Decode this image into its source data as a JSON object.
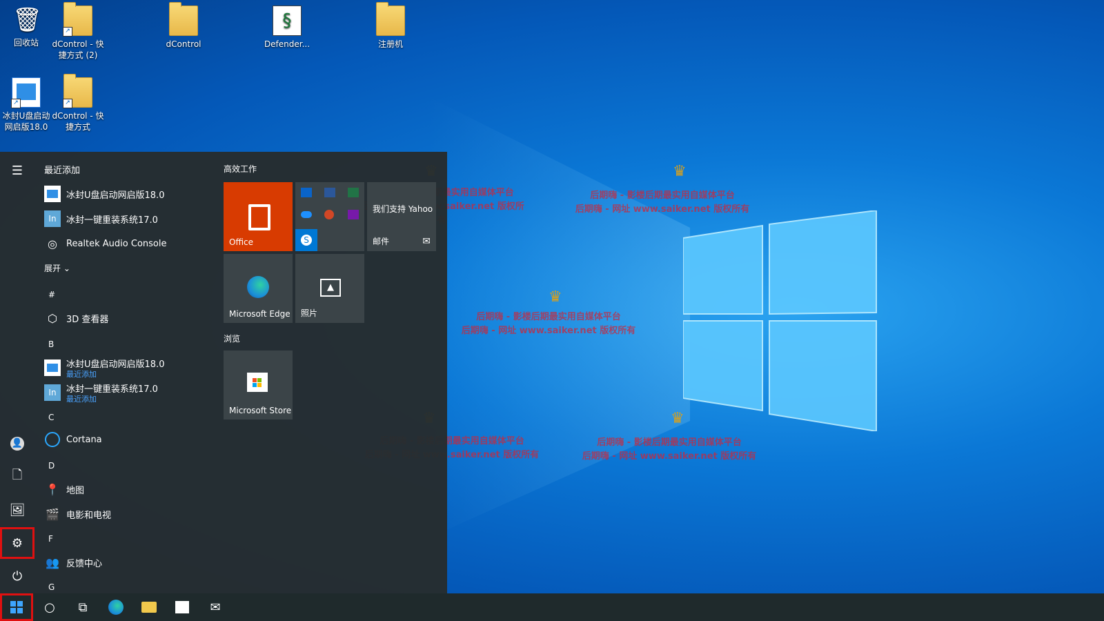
{
  "desktop": {
    "icons": [
      {
        "label": "回收站"
      },
      {
        "label": "dControl - 快捷方式 (2)"
      },
      {
        "label": "dControl"
      },
      {
        "label": "Defender..."
      },
      {
        "label": "注册机"
      },
      {
        "label": "冰封U盘启动 网启版18.0"
      },
      {
        "label": "dControl - 快捷方式"
      }
    ],
    "watermark": {
      "line1": "后期嗨 - 影楼后期最实用自媒体平台",
      "line2": "后期嗨 - 网址 www.saiker.net 版权所有"
    }
  },
  "start": {
    "recent_header": "最近添加",
    "recent": [
      "冰封U盘启动网启版18.0",
      "冰封一键重装系统17.0",
      "Realtek Audio Console"
    ],
    "expand": "展开",
    "sections": [
      {
        "letter": "#",
        "apps": [
          {
            "name": "3D 查看器"
          }
        ]
      },
      {
        "letter": "B",
        "apps": [
          {
            "name": "冰封U盘启动网启版18.0",
            "sub": "最近添加"
          },
          {
            "name": "冰封一键重装系统17.0",
            "sub": "最近添加"
          }
        ]
      },
      {
        "letter": "C",
        "apps": [
          {
            "name": "Cortana"
          }
        ]
      },
      {
        "letter": "D",
        "apps": [
          {
            "name": "地图"
          },
          {
            "name": "电影和电视"
          }
        ]
      },
      {
        "letter": "F",
        "apps": [
          {
            "name": "反馈中心"
          }
        ]
      },
      {
        "letter": "G",
        "apps": []
      }
    ],
    "tile_groups": {
      "work": "高效工作",
      "browse": "浏览"
    },
    "tiles": {
      "office": "Office",
      "yahoo": "我们支持 Yahoo",
      "mail": "邮件",
      "edge": "Microsoft Edge",
      "photos": "照片",
      "store": "Microsoft Store"
    }
  },
  "colors": {
    "office": "#d83b01",
    "accent": "#0078d7",
    "highlight": "#e01010"
  }
}
